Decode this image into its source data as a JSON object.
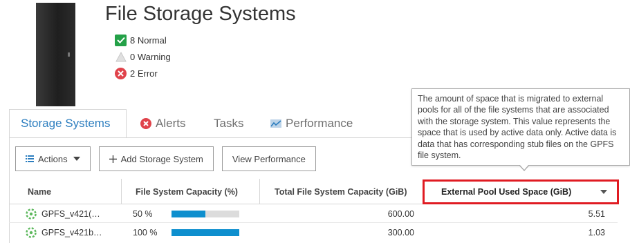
{
  "header": {
    "title": "File Storage Systems",
    "status": [
      {
        "label": "8 Normal",
        "icon": "check-icon"
      },
      {
        "label": "0 Warning",
        "icon": "warning-icon"
      },
      {
        "label": "2 Error",
        "icon": "error-icon"
      }
    ]
  },
  "tabs": [
    {
      "label": "Storage Systems",
      "active": true
    },
    {
      "label": "Alerts",
      "icon": "error-icon"
    },
    {
      "label": "Tasks"
    },
    {
      "label": "Performance",
      "icon": "chart-icon"
    }
  ],
  "toolbar": {
    "actions_label": "Actions",
    "add_label": "Add Storage System",
    "view_perf_label": "View Performance"
  },
  "table": {
    "columns": [
      "Name",
      "File System Capacity (%)",
      "Total File System Capacity (GiB)",
      "External Pool Used Space (GiB)"
    ],
    "rows": [
      {
        "name": "GPFS_v421(…",
        "capacity_pct_label": "50 %",
        "capacity_pct": 50,
        "total": "600.00",
        "external": "5.51"
      },
      {
        "name": "GPFS_v421b…",
        "capacity_pct_label": "100 %",
        "capacity_pct": 100,
        "total": "300.00",
        "external": "1.03"
      }
    ]
  },
  "tooltip": {
    "text": "The amount of space that is migrated to external pools for all of the file systems that are associated with the storage system. This value represents the space that is used by active data only. Active data is data that has corresponding stub files on the GPFS file system."
  },
  "colors": {
    "accent": "#2d7ebf",
    "bar_fill": "#0e8fce",
    "error": "#e0434b",
    "normal": "#24a148",
    "highlight": "#e01b22"
  }
}
